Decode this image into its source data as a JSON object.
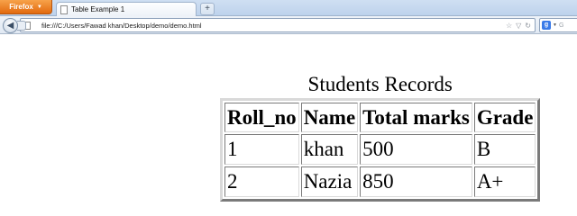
{
  "browser": {
    "menu_button": "Firefox",
    "tab_title": "Table Example 1",
    "new_tab": "+",
    "url": "file:///C:/Users/Fawad khan/Desktop/demo/demo.html",
    "search_placeholder": "G"
  },
  "page": {
    "caption": "Students Records",
    "columns": [
      "Roll_no",
      "Name",
      "Total marks",
      "Grade"
    ],
    "rows": [
      [
        "1",
        "khan",
        "500",
        "B"
      ],
      [
        "2",
        "Nazia",
        "850",
        "A+"
      ]
    ]
  },
  "colors": {
    "firefox_button": "#e26a0f",
    "chrome": "#cfdff2"
  }
}
